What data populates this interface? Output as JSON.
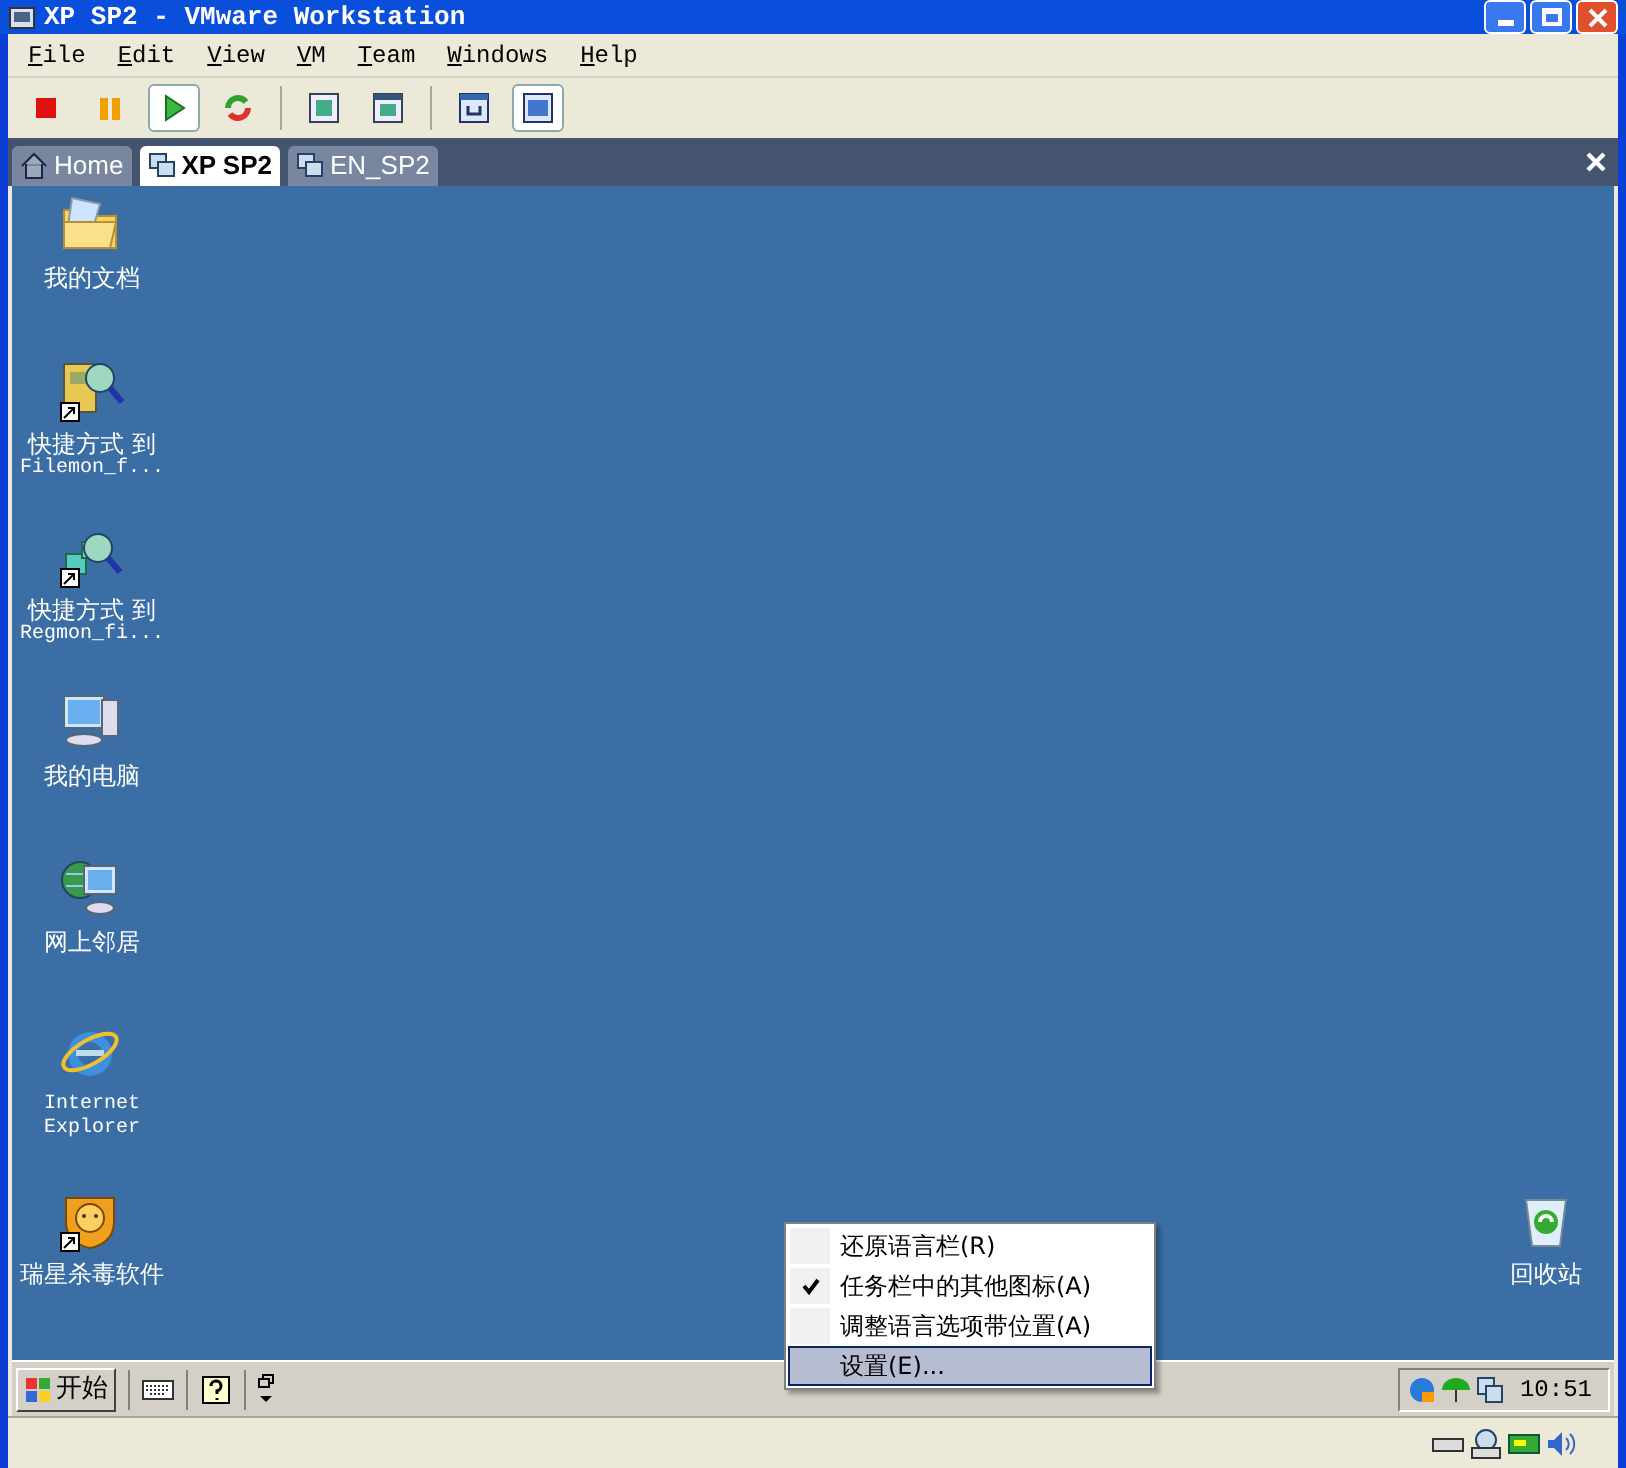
{
  "window": {
    "title": "XP SP2 - VMware Workstation"
  },
  "menu": [
    "File",
    "Edit",
    "View",
    "VM",
    "Team",
    "Windows",
    "Help"
  ],
  "toolbar": [
    {
      "kind": "stop",
      "selected": false
    },
    {
      "kind": "pause",
      "selected": false
    },
    {
      "kind": "play",
      "selected": true
    },
    {
      "kind": "reset",
      "selected": false
    },
    {
      "kind": "separator"
    },
    {
      "kind": "fullscreen",
      "selected": false
    },
    {
      "kind": "quickswitch",
      "selected": false
    },
    {
      "kind": "separator"
    },
    {
      "kind": "snapshot",
      "selected": false
    },
    {
      "kind": "console",
      "selected": true
    }
  ],
  "tabs": [
    {
      "label": "Home",
      "kind": "home",
      "selected": false
    },
    {
      "label": "XP SP2",
      "kind": "vm",
      "selected": true
    },
    {
      "label": "EN_SP2",
      "kind": "vm",
      "selected": false
    }
  ],
  "desktop_icons": [
    {
      "kind": "folder",
      "lines": [
        "我的文档"
      ],
      "shortcut": false
    },
    {
      "kind": "filemon",
      "lines": [
        "快捷方式 到",
        "Filemon_f..."
      ],
      "shortcut": true
    },
    {
      "kind": "regmon",
      "lines": [
        "快捷方式 到",
        "Regmon_fi..."
      ],
      "shortcut": true
    },
    {
      "kind": "computer",
      "lines": [
        "我的电脑"
      ],
      "shortcut": false
    },
    {
      "kind": "network",
      "lines": [
        "网上邻居"
      ],
      "shortcut": false
    },
    {
      "kind": "ie",
      "lines": [
        "Internet",
        "Explorer"
      ],
      "shortcut": false
    },
    {
      "kind": "lion",
      "lines": [
        "瑞星杀毒软件"
      ],
      "shortcut": true
    }
  ],
  "recycle_bin": {
    "label": "回收站"
  },
  "context_menu": [
    {
      "label": "还原语言栏(R)",
      "checked": false,
      "selected": false
    },
    {
      "label": "任务栏中的其他图标(A)",
      "checked": true,
      "selected": false
    },
    {
      "label": "调整语言选项带位置(A)",
      "checked": false,
      "selected": false
    },
    {
      "label": "设置(E)...",
      "checked": false,
      "selected": true
    }
  ],
  "taskbar": {
    "start": "开始",
    "clock": "10:51"
  }
}
